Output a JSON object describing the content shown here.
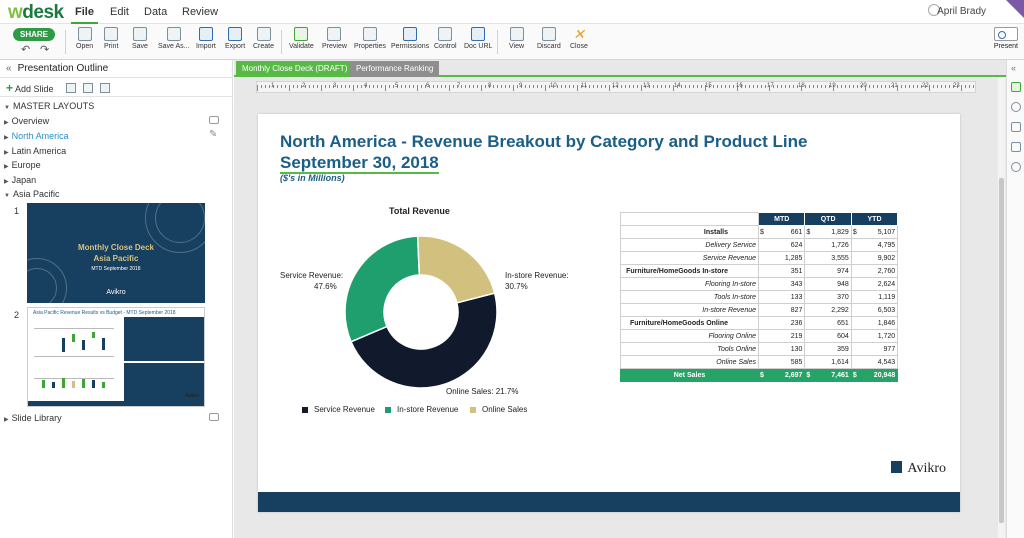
{
  "topbar": {
    "logo_w": "w",
    "logo_rest": "desk",
    "menus": [
      "File",
      "Edit",
      "Data",
      "Review"
    ],
    "user": "April Brady"
  },
  "ribbon": {
    "share": "SHARE",
    "buttons": [
      "Open",
      "Print",
      "Save",
      "Save As...",
      "Import",
      "Export",
      "Create",
      "Validate",
      "Preview",
      "Properties",
      "Permissions",
      "Control",
      "Doc URL",
      "View",
      "Discard",
      "Close"
    ],
    "present": "Present"
  },
  "sidebar": {
    "title": "Presentation Outline",
    "add_slide": "Add Slide",
    "master": "MASTER LAYOUTS",
    "items": [
      "Overview",
      "North America",
      "Latin America",
      "Europe",
      "Japan",
      "Asia Pacific"
    ],
    "slide_library": "Slide Library",
    "thumb_numbers": [
      "1",
      "2"
    ],
    "thumb1": {
      "line1": "Monthly Close Deck",
      "line2": "Asia Pacific",
      "line3": "MTD September 2018",
      "logo": "Avikro"
    },
    "thumb2": {
      "title": "Asia Pacific Revenue Results vs Budget - MTD September 2018",
      "logo": "Avikro"
    }
  },
  "tabs": [
    "Monthly Close Deck (DRAFT)",
    "Performance Ranking"
  ],
  "ruler_numbers": [
    "1",
    "2",
    "3",
    "4",
    "5",
    "6",
    "7",
    "8",
    "9",
    "10",
    "11",
    "12",
    "13",
    "14",
    "15",
    "16",
    "17",
    "18",
    "19",
    "20",
    "21",
    "22",
    "23"
  ],
  "slide": {
    "title": "North America - Revenue Breakout by Category and Product Line",
    "date": "September 30, 2018",
    "subtitle": "($'s in Millions)",
    "logo": "Avikro"
  },
  "chart_data": {
    "type": "pie",
    "title": "Total Revenue",
    "donut": true,
    "slices": [
      {
        "name": "Service Revenue",
        "value": 47.6,
        "label": "Service Revenue:",
        "pct": "47.6%",
        "color": "#111a2c"
      },
      {
        "name": "In-store Revenue",
        "value": 30.7,
        "label": "In-store Revenue:",
        "pct": "30.7%",
        "color": "#1f9e6e"
      },
      {
        "name": "Online Sales",
        "value": 21.7,
        "label": "Online Sales: 21.7%",
        "pct": "",
        "color": "#d2c17e"
      }
    ],
    "legend": [
      "Service Revenue",
      "In-store Revenue",
      "Online Sales"
    ],
    "legend_placement": "bottom"
  },
  "table": {
    "headers": [
      "MTD",
      "QTD",
      "YTD"
    ],
    "rows": [
      {
        "label": "Installs",
        "style": "bold",
        "cur": true,
        "vals": [
          "661",
          "1,829",
          "5,107"
        ]
      },
      {
        "label": "Delivery Service",
        "style": "it",
        "cur": false,
        "vals": [
          "624",
          "1,726",
          "4,795"
        ]
      },
      {
        "label": "Service Revenue",
        "style": "it",
        "cur": false,
        "vals": [
          "1,285",
          "3,555",
          "9,902"
        ]
      },
      {
        "label": "Furniture/HomeGoods In-store",
        "style": "bold",
        "cur": false,
        "vals": [
          "351",
          "974",
          "2,760"
        ]
      },
      {
        "label": "Flooring In-store",
        "style": "it",
        "cur": false,
        "vals": [
          "343",
          "948",
          "2,624"
        ]
      },
      {
        "label": "Tools In-store",
        "style": "it",
        "cur": false,
        "vals": [
          "133",
          "370",
          "1,119"
        ]
      },
      {
        "label": "In-store Revenue",
        "style": "it",
        "cur": false,
        "vals": [
          "827",
          "2,292",
          "6,503"
        ]
      },
      {
        "label": "Furniture/HomeGoods Online",
        "style": "bold",
        "cur": false,
        "vals": [
          "236",
          "651",
          "1,846"
        ]
      },
      {
        "label": "Flooring Online",
        "style": "it",
        "cur": false,
        "vals": [
          "219",
          "604",
          "1,720"
        ]
      },
      {
        "label": "Tools Online",
        "style": "it",
        "cur": false,
        "vals": [
          "130",
          "359",
          "977"
        ]
      },
      {
        "label": "Online Sales",
        "style": "it",
        "cur": false,
        "vals": [
          "585",
          "1,614",
          "4,543"
        ]
      },
      {
        "label": "Net Sales",
        "style": "total",
        "cur": true,
        "vals": [
          "2,697",
          "7,461",
          "20,948"
        ]
      }
    ]
  }
}
